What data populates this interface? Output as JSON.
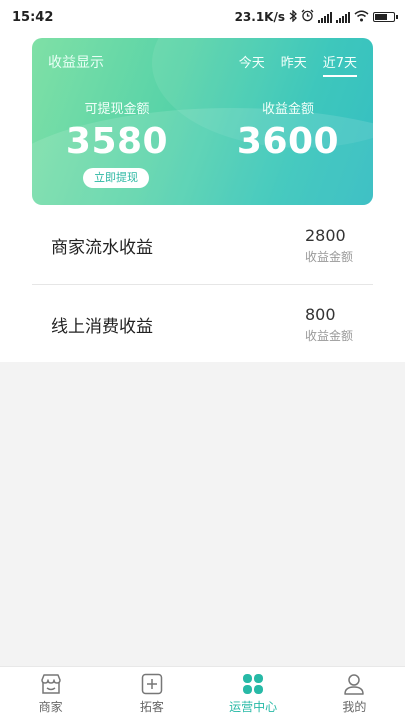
{
  "status_bar": {
    "time": "15:42",
    "net_speed": "23.1K/s",
    "battery_level": 0.6
  },
  "card": {
    "title": "收益显示",
    "tabs": [
      {
        "label": "今天",
        "active": false
      },
      {
        "label": "昨天",
        "active": false
      },
      {
        "label": "近7天",
        "active": true
      }
    ],
    "withdrawable": {
      "label": "可提现金额",
      "value": "3580"
    },
    "income": {
      "label": "收益金额",
      "value": "3600"
    },
    "withdraw_button": "立即提现"
  },
  "income_list": [
    {
      "name": "商家流水收益",
      "amount": "2800",
      "sub": "收益金额"
    },
    {
      "name": "线上消费收益",
      "amount": "800",
      "sub": "收益金额"
    }
  ],
  "bottom_nav": {
    "items": [
      {
        "label": "商家",
        "icon": "shop-icon",
        "active": false
      },
      {
        "label": "拓客",
        "icon": "plus-square-icon",
        "active": false
      },
      {
        "label": "运营中心",
        "icon": "clover-icon",
        "active": true
      },
      {
        "label": "我的",
        "icon": "person-icon",
        "active": false
      }
    ]
  },
  "colors": {
    "accent": "#27b9a6",
    "card_gradient_start": "#7fe0a6",
    "card_gradient_end": "#25b8bd"
  }
}
